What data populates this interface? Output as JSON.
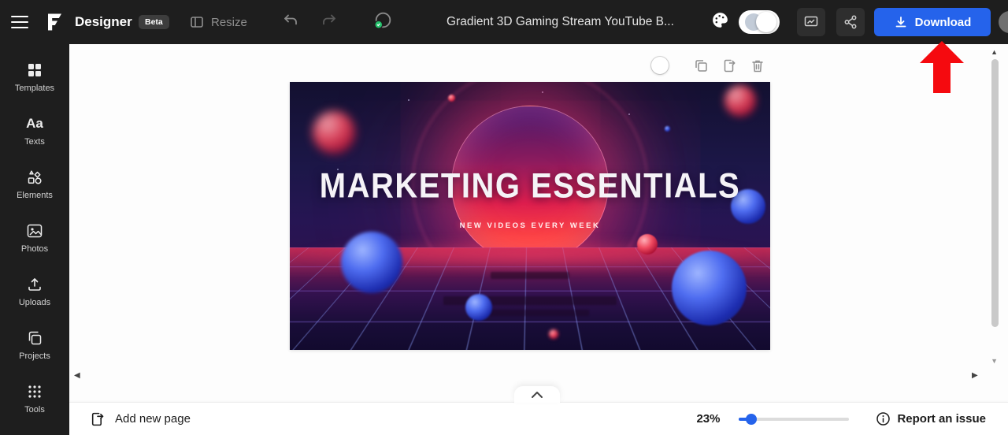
{
  "topbar": {
    "app_name": "Designer",
    "beta_badge": "Beta",
    "resize_label": "Resize",
    "doc_title": "Gradient 3D Gaming Stream YouTube B...",
    "download_label": "Download"
  },
  "sidebar": {
    "texts_icon_glyph": "Aa",
    "items": [
      {
        "label": "Templates",
        "icon": "templates-grid-icon"
      },
      {
        "label": "Texts",
        "icon": "texts-aa-icon"
      },
      {
        "label": "Elements",
        "icon": "elements-shapes-icon"
      },
      {
        "label": "Photos",
        "icon": "photos-image-icon"
      },
      {
        "label": "Uploads",
        "icon": "uploads-arrow-icon"
      },
      {
        "label": "Projects",
        "icon": "projects-copy-icon"
      },
      {
        "label": "Tools",
        "icon": "tools-dots-grid-icon"
      }
    ]
  },
  "canvas": {
    "headline": "MARKETING ESSENTIALS",
    "subheadline": "NEW VIDEOS EVERY WEEK"
  },
  "bottombar": {
    "add_new_page_label": "Add new page",
    "zoom_value": "23%",
    "report_issue_label": "Report an issue"
  },
  "icons": {
    "hamburger": "menu bars",
    "undo": "curved-arrow-left",
    "redo": "curved-arrow-right",
    "autosave": "circle with green check",
    "palette": "paint palette",
    "feedback": "board with chart line",
    "share": "share nodes",
    "download": "arrow into tray",
    "duplicate-page": "two overlapping squares",
    "export-page": "page with arrow",
    "delete-page": "trash can",
    "add-page": "page with arrow",
    "report-info": "info circle",
    "collapse": "chevron up"
  },
  "colors": {
    "topbar_bg": "#1e1e1e",
    "accent_blue": "#2563eb",
    "annotation_red": "#f50a0f",
    "design_glow_pink": "#ff3c6e"
  },
  "annotation": {
    "type": "red-arrow-up",
    "points_at": "download-button"
  }
}
